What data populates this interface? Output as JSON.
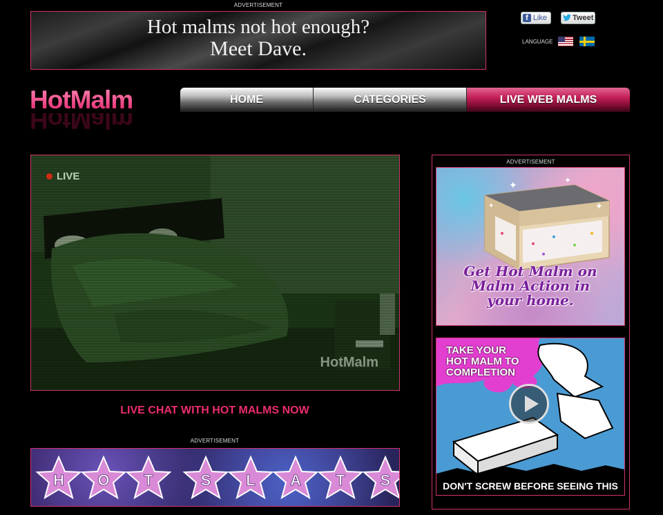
{
  "top_ad": {
    "label": "ADVERTISEMENT",
    "line1": "Hot malms not hot enough?",
    "line2": "Meet Dave."
  },
  "social": {
    "like_label": "Like",
    "tweet_label": "Tweet",
    "language_label": "LANGUAGE"
  },
  "logo": {
    "text": "HotMalm"
  },
  "nav": {
    "items": [
      {
        "label": "HOME",
        "active": false
      },
      {
        "label": "CATEGORIES",
        "active": false
      },
      {
        "label": "LIVE WEB MALMS",
        "active": true
      }
    ]
  },
  "webcam": {
    "live_label": "LIVE",
    "watermark": "HotMalm"
  },
  "live_chat_link": "LIVE CHAT WITH HOT MALMS NOW",
  "bottom_ad": {
    "label": "ADVERTISEMENT",
    "letters": [
      "H",
      "O",
      "T",
      "S",
      "L",
      "A",
      "T",
      "S"
    ]
  },
  "right_col": {
    "ad_label": "ADVERTISEMENT",
    "bed_ad": {
      "lines": [
        "Get Hot Malm on",
        "Malm Action in",
        "your home."
      ]
    },
    "completion_ad": {
      "headline": [
        "TAKE YOUR",
        "HOT MALM TO",
        "COMPLETION"
      ],
      "footer": "DON'T SCREW BEFORE SEEING THIS"
    }
  },
  "colors": {
    "accent_pink": "#d2336d",
    "link_pink": "#ec2d6b",
    "nav_active": "#c42058",
    "background": "#000000"
  }
}
